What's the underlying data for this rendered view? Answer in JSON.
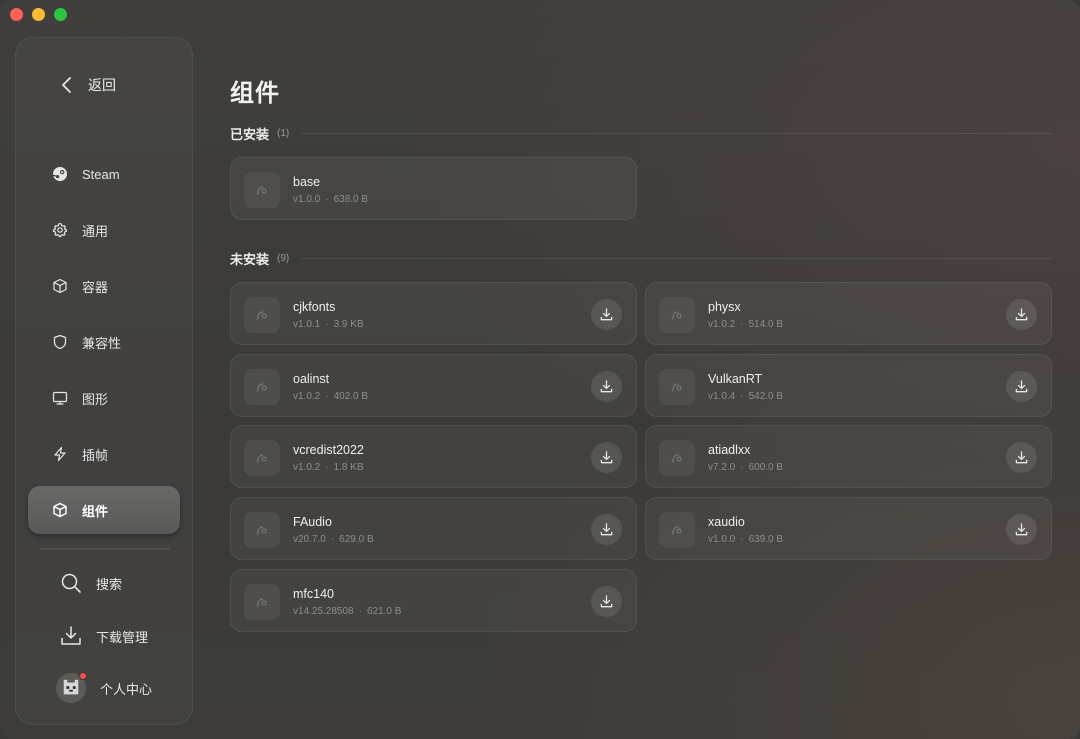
{
  "window": {
    "traffic_lights": [
      "close",
      "minimize",
      "maximize"
    ],
    "colors": {
      "close": "#fe5f57",
      "minimize": "#febc2e",
      "maximize": "#28c840"
    }
  },
  "sidebar": {
    "back_label": "返回",
    "items": [
      {
        "label": "Steam",
        "icon": "steam-icon"
      },
      {
        "label": "通用",
        "icon": "gear-icon"
      },
      {
        "label": "容器",
        "icon": "box-icon"
      },
      {
        "label": "兼容性",
        "icon": "shield-icon"
      },
      {
        "label": "图形",
        "icon": "monitor-icon"
      },
      {
        "label": "插帧",
        "icon": "lightning-icon"
      },
      {
        "label": "组件",
        "icon": "cube-icon",
        "active": true
      }
    ],
    "bottom": {
      "search_label": "搜索",
      "downloads_label": "下载管理",
      "profile_label": "个人中心"
    }
  },
  "main": {
    "title": "组件",
    "installed": {
      "label": "已安装",
      "count": "(1)",
      "items": [
        {
          "name": "base",
          "version": "v1.0.0",
          "size": "638.0 B"
        }
      ]
    },
    "not_installed": {
      "label": "未安装",
      "count": "(9)",
      "items": [
        {
          "name": "cjkfonts",
          "version": "v1.0.1",
          "size": "3.9 KB"
        },
        {
          "name": "physx",
          "version": "v1.0.2",
          "size": "514.0 B"
        },
        {
          "name": "oalinst",
          "version": "v1.0.2",
          "size": "402.0 B"
        },
        {
          "name": "VulkanRT",
          "version": "v1.0.4",
          "size": "542.0 B"
        },
        {
          "name": "vcredist2022",
          "version": "v1.0.2",
          "size": "1.8 KB"
        },
        {
          "name": "atiadlxx",
          "version": "v7.2.0",
          "size": "600.0 B"
        },
        {
          "name": "FAudio",
          "version": "v20.7.0",
          "size": "629.0 B"
        },
        {
          "name": "xaudio",
          "version": "v1.0.0",
          "size": "639.0 B"
        },
        {
          "name": "mfc140",
          "version": "v14.25.28508",
          "size": "621.0 B"
        }
      ]
    },
    "meta_separator": "·"
  }
}
